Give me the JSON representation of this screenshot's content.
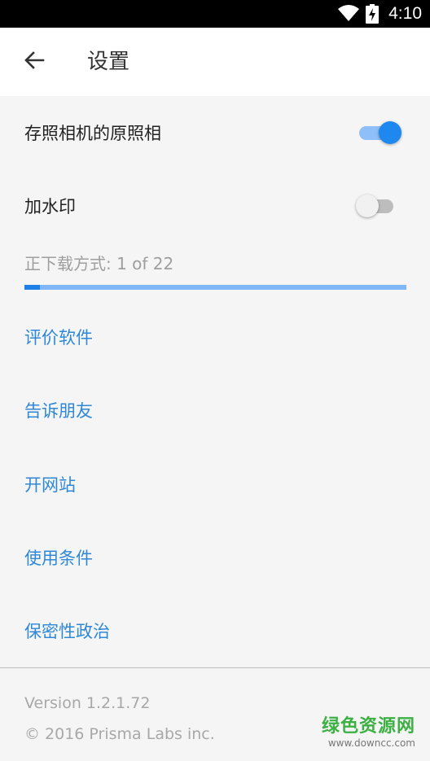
{
  "status_bar": {
    "time": "4:10",
    "icons": [
      "wifi-icon",
      "battery-charging-icon"
    ]
  },
  "header": {
    "title": "设置",
    "back_icon": "arrow-left-icon"
  },
  "settings": {
    "save_original": {
      "label": "存照相机的原照相",
      "enabled": true
    },
    "watermark": {
      "label": "加水印",
      "enabled": false
    }
  },
  "download": {
    "label": "正下载方式: 1 of 22",
    "progress_fraction": 0.04
  },
  "links": [
    {
      "label": "评价软件"
    },
    {
      "label": "告诉朋友"
    },
    {
      "label": "开网站"
    },
    {
      "label": "使用条件"
    },
    {
      "label": "保密性政治"
    }
  ],
  "footer": {
    "version": "Version 1.2.1.72",
    "copyright": "© 2016 Prisma Labs inc."
  },
  "watermark_overlay": {
    "main": "绿色资源网",
    "url": "www.downcc.com"
  },
  "colors": {
    "accent": "#1e88f0",
    "link": "#2e88d6",
    "watermark_green": "#3cb043"
  }
}
